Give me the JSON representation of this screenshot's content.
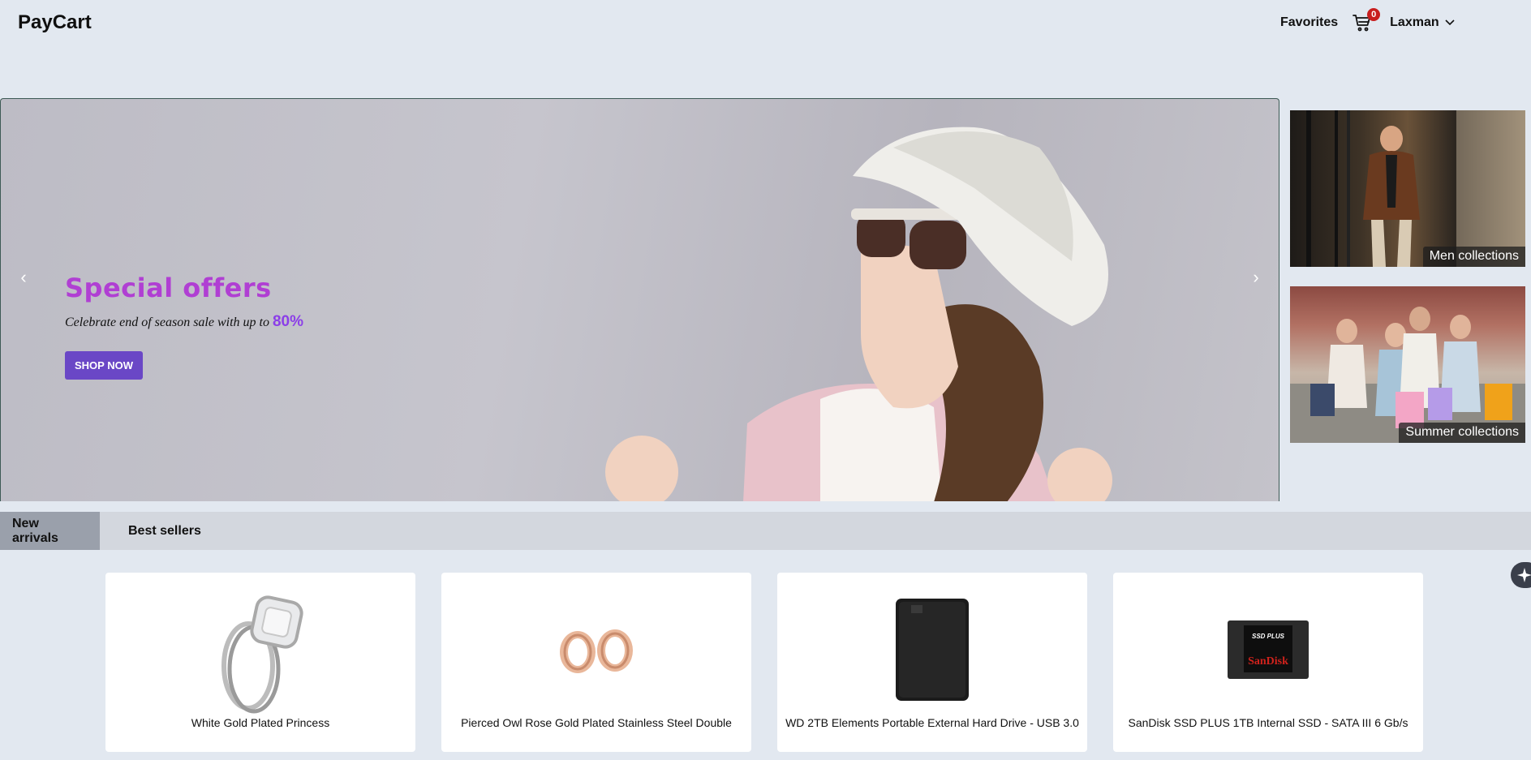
{
  "header": {
    "logo": "PayCart",
    "favorites_label": "Favorites",
    "cart_count": "0",
    "user_name": "Laxman"
  },
  "hero": {
    "title": "Special offers",
    "subtitle": "Celebrate end of season sale with up to",
    "discount": "80%",
    "button_label": "SHOP NOW"
  },
  "collections": [
    {
      "label": "Men collections"
    },
    {
      "label": "Summer collections"
    }
  ],
  "tabs": [
    {
      "label": "New arrivals",
      "active": true
    },
    {
      "label": "Best sellers",
      "active": false
    }
  ],
  "products": [
    {
      "title": "White Gold Plated Princess",
      "icon": "ring-image"
    },
    {
      "title": "Pierced Owl Rose Gold Plated Stainless Steel Double",
      "icon": "earrings-image"
    },
    {
      "title": "WD 2TB Elements Portable External Hard Drive - USB 3.0",
      "icon": "hard-drive-image"
    },
    {
      "title": "SanDisk SSD PLUS 1TB Internal SSD - SATA III 6 Gb/s",
      "icon": "ssd-image",
      "image_text": [
        "SSD PLUS",
        "SanDisk"
      ]
    }
  ],
  "colors": {
    "background": "#e2e8f0",
    "accent_purple": "#6a47c6",
    "title_magenta": "#b03fd3",
    "badge_red": "#c81e1e"
  }
}
